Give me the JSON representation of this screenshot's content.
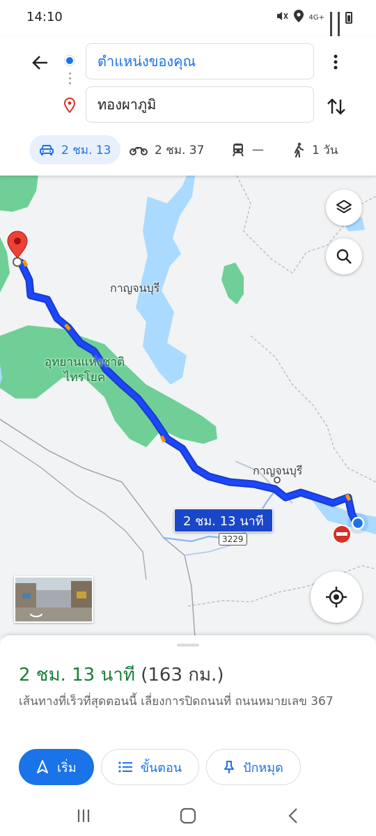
{
  "status_bar": {
    "time": "14:10",
    "network": "4G+",
    "icons": [
      "mute-icon",
      "location-icon",
      "signal-icon",
      "battery-icon"
    ]
  },
  "directions": {
    "origin": "ตำแหน่งของคุณ",
    "destination": "ทองผาภูมิ",
    "modes": [
      {
        "name": "car",
        "label": "2 ชม. 13",
        "active": true
      },
      {
        "name": "motorcycle",
        "label": "2 ชม. 37",
        "active": false
      },
      {
        "name": "transit",
        "label": "—",
        "active": false
      },
      {
        "name": "walking",
        "label": "1 วัน",
        "active": false
      }
    ]
  },
  "map": {
    "labels": {
      "province": "กาญจนบุรี",
      "city": "กาญจนบุรี",
      "park": "อุทยานแห่งชาติ\nไทรโยค",
      "road_number": "3229"
    },
    "route_time_label": "2 ชม. 13 นาที",
    "colors": {
      "route": "#1a47ff",
      "route_outline": "#1a3bbf",
      "park": "#6fcf97",
      "water": "#aadaff",
      "land": "#f1f3f4",
      "destination_pin": "#ea4335",
      "origin_dot": "#1a73e8"
    }
  },
  "sheet": {
    "duration": "2 ชม. 13 นาที",
    "distance": "(163 กม.)",
    "description": "เส้นทางที่เร็วที่สุดตอนนี้ เลี่ยงการปิดถนนที่ ถนนหมายเลข 367",
    "buttons": {
      "start": "เริ่ม",
      "steps": "ขั้นตอน",
      "pin": "ปักหมุด"
    }
  },
  "nav_bar": {
    "items": [
      "recent-apps-icon",
      "home-icon",
      "back-icon"
    ]
  }
}
